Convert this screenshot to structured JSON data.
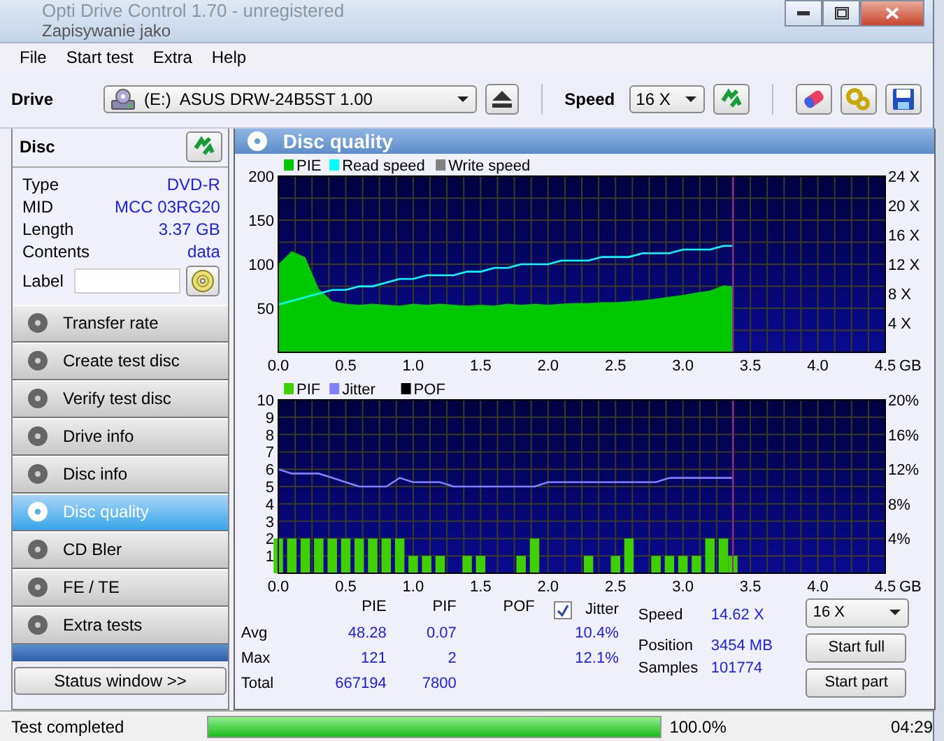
{
  "window": {
    "title": "Opti Drive Control 1.70 - unregistered",
    "behind_title": "Zapisywanie jako"
  },
  "menu": [
    {
      "label": "File"
    },
    {
      "label": "Start test"
    },
    {
      "label": "Extra"
    },
    {
      "label": "Help"
    }
  ],
  "toolbar": {
    "drive_label": "Drive",
    "drive": "(E:)  ASUS DRW-24B5ST 1.00",
    "speed_label": "Speed",
    "speed": "16 X"
  },
  "disc": {
    "title": "Disc",
    "fields": [
      {
        "label": "Type",
        "value": "DVD-R"
      },
      {
        "label": "MID",
        "value": "MCC 03RG20"
      },
      {
        "label": "Length",
        "value": "3.37 GB"
      },
      {
        "label": "Contents",
        "value": "data"
      }
    ],
    "label_field": {
      "label": "Label"
    }
  },
  "nav": [
    {
      "label": "Transfer rate",
      "selected": false
    },
    {
      "label": "Create test disc",
      "selected": false
    },
    {
      "label": "Verify test disc",
      "selected": false
    },
    {
      "label": "Drive info",
      "selected": false
    },
    {
      "label": "Disc info",
      "selected": false
    },
    {
      "label": "Disc quality",
      "selected": true
    },
    {
      "label": "CD Bler",
      "selected": false
    },
    {
      "label": "FE / TE",
      "selected": false
    },
    {
      "label": "Extra tests",
      "selected": false
    }
  ],
  "status_window_button": "Status window >>",
  "panel": {
    "title": "Disc quality",
    "charts": [
      {
        "chart_data": {
          "type": "area",
          "xlabel": "GB",
          "grid": true,
          "legend": "top",
          "ref_lines": [
            {
              "axis": "x",
              "value": 3.37,
              "color": "#a020a0"
            }
          ],
          "x": [
            0,
            0.1,
            0.2,
            0.3,
            0.4,
            0.5,
            0.6,
            0.7,
            0.8,
            0.9,
            1.0,
            1.1,
            1.2,
            1.3,
            1.4,
            1.5,
            1.6,
            1.7,
            1.8,
            1.9,
            2.0,
            2.1,
            2.2,
            2.3,
            2.4,
            2.5,
            2.6,
            2.7,
            2.8,
            2.9,
            3.0,
            3.1,
            3.2,
            3.3,
            3.37
          ],
          "series": [
            {
              "name": "PIE",
              "color": "#00c800",
              "values": [
                100,
                115,
                108,
                72,
                58,
                55,
                54,
                55,
                54,
                53,
                55,
                54,
                55,
                54,
                53,
                54,
                53,
                55,
                54,
                55,
                54,
                55,
                56,
                56,
                57,
                57,
                58,
                59,
                61,
                63,
                65,
                68,
                70,
                76,
                75
              ]
            },
            {
              "name": "Read speed",
              "type": "line",
              "color": "#00ffff",
              "axis": "y2",
              "values": [
                6.5,
                7,
                7.5,
                8,
                8.5,
                8.5,
                9,
                9,
                9.5,
                10,
                10,
                10.5,
                10.5,
                10.5,
                11,
                11,
                11.5,
                11.5,
                12,
                12,
                12,
                12.5,
                12.5,
                12.5,
                13,
                13,
                13,
                13.5,
                13.5,
                13.5,
                14,
                14,
                14,
                14.5,
                14.5
              ]
            },
            {
              "name": "Write speed",
              "color": "#808080",
              "axis": "y2",
              "values": [
                null,
                null,
                null,
                null,
                null,
                null,
                null,
                null,
                null,
                null,
                null,
                null,
                null,
                null,
                null,
                null,
                null,
                null,
                null,
                null,
                null,
                null,
                null,
                null,
                null,
                null,
                null,
                null,
                null,
                null,
                null,
                null,
                null,
                null,
                null
              ]
            }
          ],
          "xlim": [
            0,
            4.5
          ],
          "ylim": [
            0,
            200
          ],
          "y2lim": [
            0,
            24
          ],
          "xticks": [
            {
              "value": 0,
              "label": "0.0"
            },
            {
              "value": 0.5,
              "label": "0.5"
            },
            {
              "value": 1,
              "label": "1.0"
            },
            {
              "value": 1.5,
              "label": "1.5"
            },
            {
              "value": 2,
              "label": "2.0"
            },
            {
              "value": 2.5,
              "label": "2.5"
            },
            {
              "value": 3,
              "label": "3.0"
            },
            {
              "value": 3.5,
              "label": "3.5"
            },
            {
              "value": 4,
              "label": "4.0"
            },
            {
              "value": 4.5,
              "label": "4.5"
            }
          ],
          "yticks": [
            50,
            100,
            150,
            200
          ],
          "y2ticks": [
            {
              "value": 4,
              "label": "4 X"
            },
            {
              "value": 8,
              "label": "8 X"
            },
            {
              "value": 12,
              "label": "12 X"
            },
            {
              "value": 16,
              "label": "16 X"
            },
            {
              "value": 20,
              "label": "20 X"
            },
            {
              "value": 24,
              "label": "24 X"
            }
          ]
        }
      },
      {
        "chart_data": {
          "type": "bar",
          "xlabel": "GB",
          "grid": true,
          "legend": "top",
          "ref_lines": [
            {
              "axis": "x",
              "value": 3.37,
              "color": "#a020a0"
            }
          ],
          "x": [
            0,
            0.1,
            0.2,
            0.3,
            0.4,
            0.5,
            0.6,
            0.7,
            0.8,
            0.9,
            1.0,
            1.1,
            1.2,
            1.3,
            1.4,
            1.5,
            1.6,
            1.7,
            1.8,
            1.9,
            2.0,
            2.1,
            2.2,
            2.3,
            2.4,
            2.5,
            2.6,
            2.7,
            2.8,
            2.9,
            3.0,
            3.1,
            3.2,
            3.3,
            3.37
          ],
          "series": [
            {
              "name": "PIF",
              "color": "#40d000",
              "values": [
                2,
                2,
                2,
                2,
                2,
                2,
                2,
                2,
                2,
                2,
                1,
                1,
                1,
                0,
                1,
                1,
                0,
                0,
                1,
                2,
                0,
                0,
                0,
                1,
                0,
                1,
                2,
                0,
                1,
                1,
                1,
                1,
                2,
                2,
                1
              ]
            },
            {
              "name": "Jitter",
              "type": "line",
              "color": "#8080ff",
              "axis": "y2",
              "values": [
                12.0,
                11.5,
                11.5,
                11.5,
                11.0,
                10.5,
                10.0,
                10.0,
                10.0,
                11.0,
                10.5,
                10.5,
                10.5,
                10.0,
                10.0,
                10.0,
                10.0,
                10.0,
                10.0,
                10.0,
                10.5,
                10.5,
                10.5,
                10.5,
                10.5,
                10.5,
                10.5,
                10.5,
                10.5,
                11.0,
                11.0,
                11.0,
                11.0,
                11.0,
                11.0
              ]
            },
            {
              "name": "POF",
              "color": "#000000",
              "values": [
                null,
                null,
                null,
                null,
                null,
                null,
                null,
                null,
                null,
                null,
                null,
                null,
                null,
                null,
                null,
                null,
                null,
                null,
                null,
                null,
                null,
                null,
                null,
                null,
                null,
                null,
                null,
                null,
                null,
                null,
                null,
                null,
                null,
                null,
                null
              ]
            }
          ],
          "xlim": [
            0,
            4.5
          ],
          "ylim": [
            0,
            10
          ],
          "y2lim": [
            0,
            20
          ],
          "xticks": [
            {
              "value": 0,
              "label": "0.0"
            },
            {
              "value": 0.5,
              "label": "0.5"
            },
            {
              "value": 1,
              "label": "1.0"
            },
            {
              "value": 1.5,
              "label": "1.5"
            },
            {
              "value": 2,
              "label": "2.0"
            },
            {
              "value": 2.5,
              "label": "2.5"
            },
            {
              "value": 3,
              "label": "3.0"
            },
            {
              "value": 3.5,
              "label": "3.5"
            },
            {
              "value": 4,
              "label": "4.0"
            },
            {
              "value": 4.5,
              "label": "4.5"
            }
          ],
          "yticks": [
            1,
            2,
            3,
            4,
            5,
            6,
            7,
            8,
            9,
            10
          ],
          "y2ticks": [
            {
              "value": 4,
              "label": "4%"
            },
            {
              "value": 8,
              "label": "8%"
            },
            {
              "value": 12,
              "label": "12%"
            },
            {
              "value": 16,
              "label": "16%"
            },
            {
              "value": 20,
              "label": "20%"
            }
          ]
        }
      }
    ]
  },
  "stats": {
    "columns": [
      {
        "label": "PIE"
      },
      {
        "label": "PIF"
      },
      {
        "label": "POF"
      },
      {
        "label": "Jitter",
        "checked": true
      }
    ],
    "rows": [
      {
        "label": "Avg",
        "pie": "48.28",
        "pif": "0.07",
        "jitter": "10.4%"
      },
      {
        "label": "Max",
        "pie": "121",
        "pif": "2",
        "jitter": "12.1%"
      },
      {
        "label": "Total",
        "pie": "667194",
        "pif": "7800"
      }
    ]
  },
  "readings": [
    {
      "label": "Speed",
      "value": "14.62 X"
    },
    {
      "label": "Position",
      "value": "3454 MB"
    },
    {
      "label": "Samples",
      "value": "101774"
    }
  ],
  "test_speed": "16 X",
  "buttons": [
    {
      "label": "Start full"
    },
    {
      "label": "Start part"
    }
  ],
  "status_bar": {
    "message": "Test completed",
    "progress": {
      "level": 1.0,
      "text": "100.0%"
    },
    "time": "04:29"
  }
}
